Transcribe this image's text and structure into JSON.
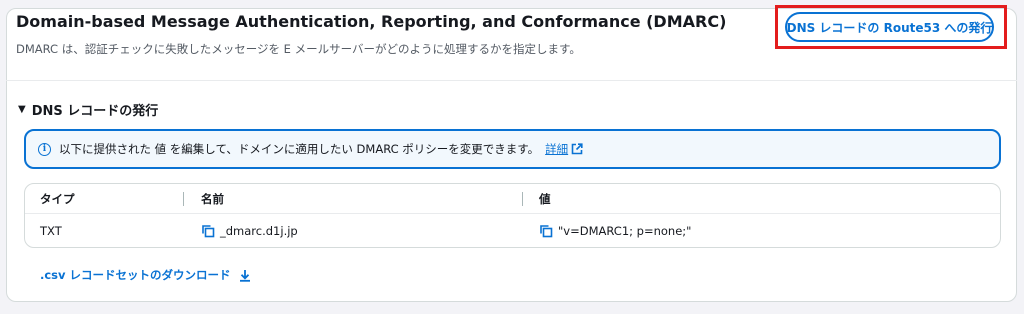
{
  "header": {
    "title": "Domain-based Message Authentication, Reporting, and Conformance (DMARC)",
    "description": "DMARC は、認証チェックに失敗したメッセージを E メールサーバーがどのように処理するかを指定します。",
    "route53_button": "DNS レコードの Route53 への発行"
  },
  "section": {
    "caret": "▼",
    "title": "DNS レコードの発行"
  },
  "info": {
    "text": "以下に提供された 値 を編集して、ドメインに適用したい DMARC ポリシーを変更できます。",
    "link": "詳細"
  },
  "table": {
    "columns": [
      "タイプ",
      "名前",
      "値"
    ],
    "rows": [
      {
        "type": "TXT",
        "name": "_dmarc.d1j.jp",
        "value": "\"v=DMARC1; p=none;\""
      }
    ]
  },
  "download_link": ".csv レコードセットのダウンロード",
  "colors": {
    "accent": "#0972d3",
    "highlight_frame": "#e31d1d"
  }
}
